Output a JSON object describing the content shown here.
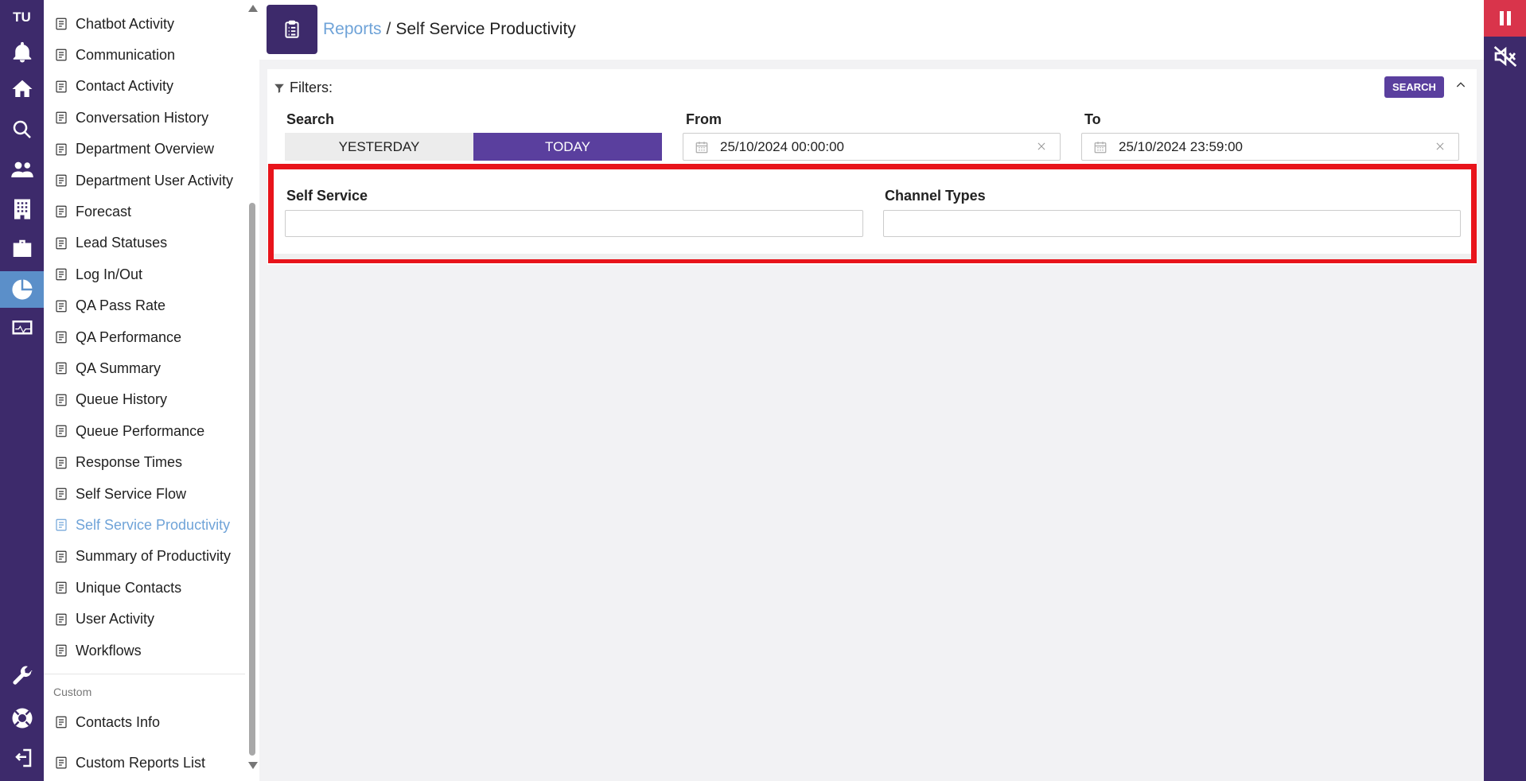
{
  "rail": {
    "initials": "TU",
    "icons": [
      "bell-icon",
      "home-icon",
      "search-icon",
      "users-icon",
      "building-icon",
      "briefcase-icon",
      "reports-icon",
      "monitor-icon",
      "wrench-icon",
      "support-icon",
      "logout-icon"
    ]
  },
  "sidebar": {
    "items": [
      {
        "label": "Chatbot Activity",
        "icon": "sigma-icon"
      },
      {
        "label": "Communication",
        "icon": "communication-icon"
      },
      {
        "label": "Contact Activity",
        "icon": "contact-icon"
      },
      {
        "label": "Conversation History",
        "icon": "history-icon"
      },
      {
        "label": "Department Overview",
        "icon": "department-icon"
      },
      {
        "label": "Department User Activity",
        "icon": "user-activity-icon"
      },
      {
        "label": "Forecast",
        "icon": "forecast-icon"
      },
      {
        "label": "Lead Statuses",
        "icon": "lead-statuses-icon"
      },
      {
        "label": "Log In/Out",
        "icon": "login-icon"
      },
      {
        "label": "QA Pass Rate",
        "icon": "document-check-icon"
      },
      {
        "label": "QA Performance",
        "icon": "document-chart-icon"
      },
      {
        "label": "QA Summary",
        "icon": "document-list-icon"
      },
      {
        "label": "Queue History",
        "icon": "watch-icon"
      },
      {
        "label": "Queue Performance",
        "icon": "gauge-icon"
      },
      {
        "label": "Response Times",
        "icon": "stopwatch-icon"
      },
      {
        "label": "Self Service Flow",
        "icon": "robot-icon"
      },
      {
        "label": "Self Service Productivity",
        "icon": "robot-desk-icon",
        "active": true
      },
      {
        "label": "Summary of Productivity",
        "icon": "clipboard-icon"
      },
      {
        "label": "Unique Contacts",
        "icon": "id-card-icon"
      },
      {
        "label": "User Activity",
        "icon": "user-chart-icon"
      },
      {
        "label": "Workflows",
        "icon": "paper-plane-icon"
      }
    ],
    "custom_label": "Custom",
    "custom_items": [
      {
        "label": "Contacts Info",
        "icon": "contact-card-icon"
      },
      {
        "label": "Custom Reports List",
        "icon": "table-icon"
      }
    ]
  },
  "header": {
    "breadcrumb_link": "Reports",
    "breadcrumb_sep": "/",
    "breadcrumb_current": "Self Service Productivity"
  },
  "filters": {
    "title": "Filters:",
    "search_button": "SEARCH",
    "search_label": "Search",
    "yesterday": "YESTERDAY",
    "today": "TODAY",
    "from_label": "From",
    "from_value": "25/10/2024 00:00:00",
    "to_label": "To",
    "to_value": "25/10/2024 23:59:00",
    "self_service_label": "Self Service",
    "channel_types_label": "Channel Types"
  },
  "colors": {
    "brand": "#3d2a6b",
    "accent": "#5a3f9e",
    "link": "#6fa3d8",
    "highlight": "#e8141b",
    "pause": "#d9344b"
  }
}
